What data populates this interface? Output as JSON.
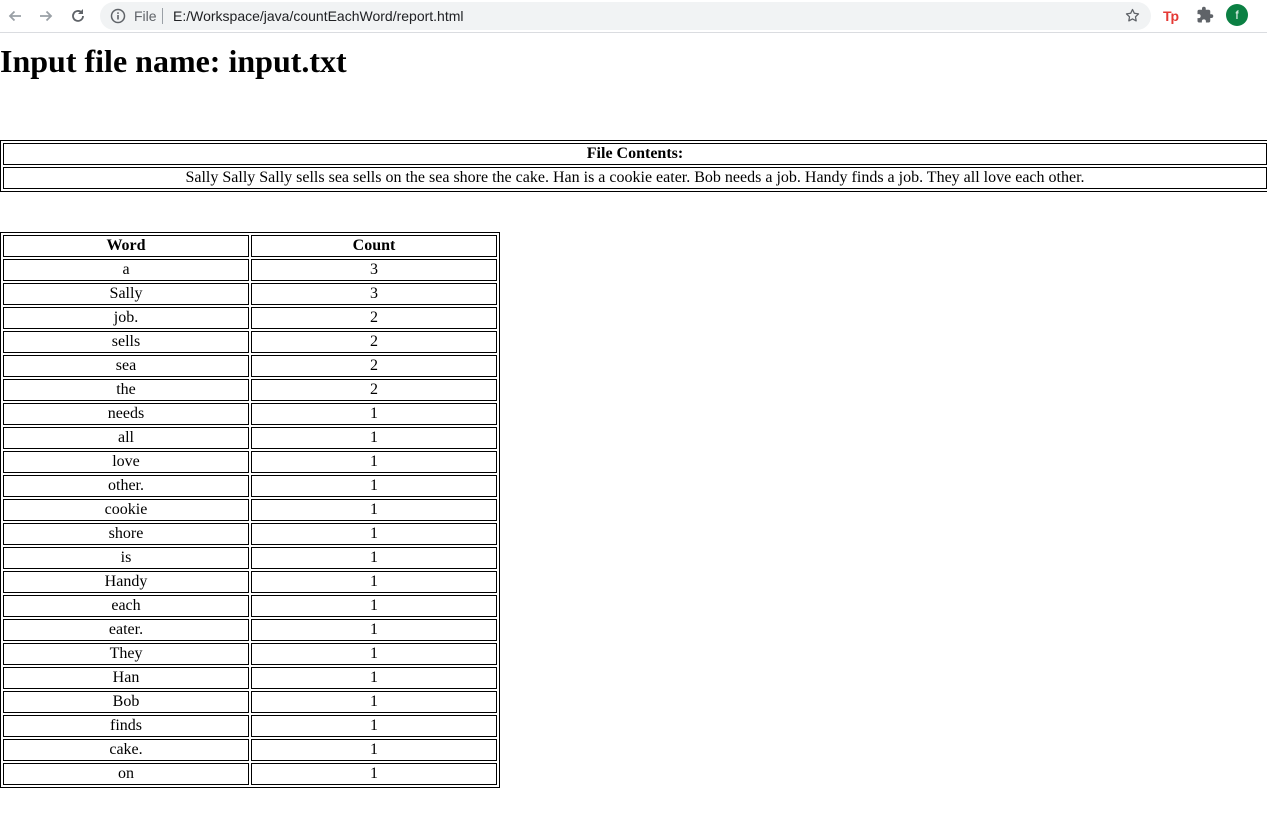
{
  "browser": {
    "scheme": "File",
    "url": "E:/Workspace/java/countEachWord/report.html",
    "extension_label": "Tp",
    "profile_initial": "f",
    "icons": [
      "back-arrow-icon",
      "forward-arrow-icon",
      "reload-icon",
      "info-icon",
      "star-icon",
      "puzzle-icon"
    ],
    "colors": {
      "avatar": "#0b8043",
      "extension": "#e53935"
    }
  },
  "page": {
    "title": "Input file name: input.txt",
    "contents_header": "File Contents:",
    "contents_text": "Sally Sally Sally sells sea sells on the sea shore the cake. Han is a cookie eater. Bob needs a job. Handy finds a job. They all love each other.",
    "table_headers": {
      "word": "Word",
      "count": "Count"
    },
    "rows": [
      {
        "word": "a",
        "count": "3"
      },
      {
        "word": "Sally",
        "count": "3"
      },
      {
        "word": "job.",
        "count": "2"
      },
      {
        "word": "sells",
        "count": "2"
      },
      {
        "word": "sea",
        "count": "2"
      },
      {
        "word": "the",
        "count": "2"
      },
      {
        "word": "needs",
        "count": "1"
      },
      {
        "word": "all",
        "count": "1"
      },
      {
        "word": "love",
        "count": "1"
      },
      {
        "word": "other.",
        "count": "1"
      },
      {
        "word": "cookie",
        "count": "1"
      },
      {
        "word": "shore",
        "count": "1"
      },
      {
        "word": "is",
        "count": "1"
      },
      {
        "word": "Handy",
        "count": "1"
      },
      {
        "word": "each",
        "count": "1"
      },
      {
        "word": "eater.",
        "count": "1"
      },
      {
        "word": "They",
        "count": "1"
      },
      {
        "word": "Han",
        "count": "1"
      },
      {
        "word": "Bob",
        "count": "1"
      },
      {
        "word": "finds",
        "count": "1"
      },
      {
        "word": "cake.",
        "count": "1"
      },
      {
        "word": "on",
        "count": "1"
      }
    ]
  }
}
